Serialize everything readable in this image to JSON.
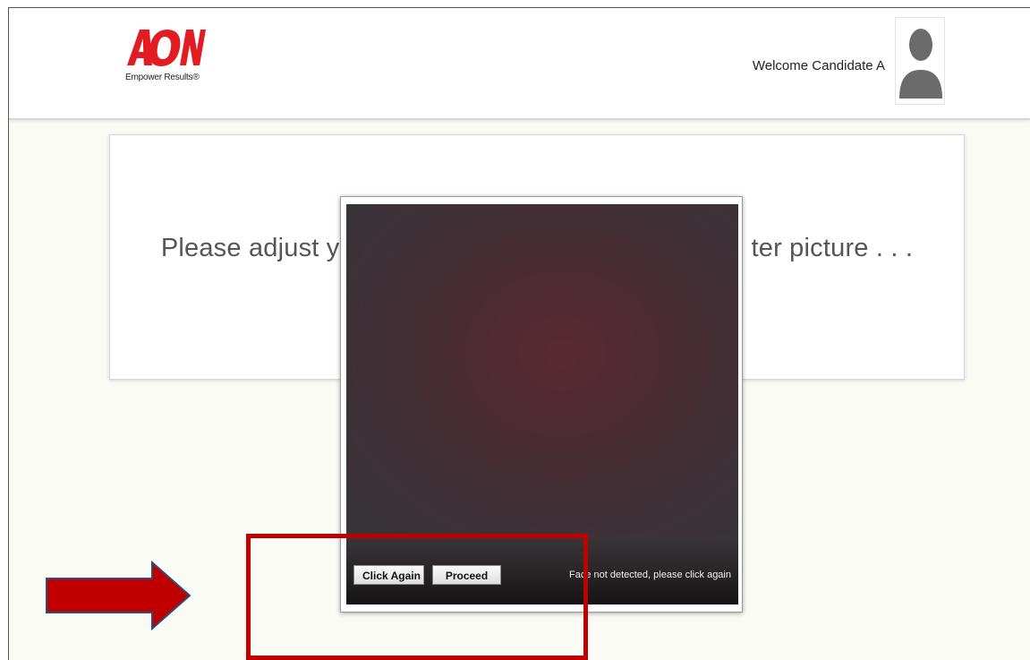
{
  "header": {
    "logo_text": "AON",
    "logo_tagline": "Empower Results®",
    "welcome_text": "Welcome Candidate A",
    "avatar_icon": "user-silhouette-icon"
  },
  "card": {
    "instruction_left": "Please adjust y",
    "instruction_right": "ter picture . . ."
  },
  "modal": {
    "click_again_label": "Click Again",
    "proceed_label": "Proceed",
    "status_message": "Face not detected, please click again"
  },
  "annotations": {
    "highlight_color": "#c00000",
    "arrow_color": "#c00000",
    "arrow_icon": "right-arrow-icon"
  },
  "colors": {
    "brand_red": "#e31b23",
    "page_background": "#fbfbf6"
  }
}
